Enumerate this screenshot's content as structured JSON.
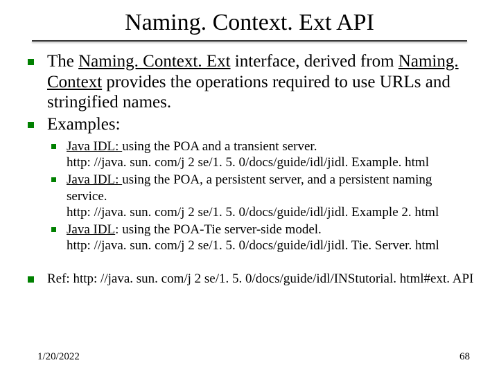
{
  "title": "Naming. Context. Ext API",
  "bullets": [
    {
      "pre": "The ",
      "u1": "Naming. Context. Ext",
      "mid": " interface, derived from ",
      "u2": "Naming. Context",
      "post": " provides the operations required to use URLs and stringified names."
    },
    {
      "text": "Examples:"
    }
  ],
  "sub": [
    {
      "u": "Java IDL: ",
      "rest": "using the POA and a transient server.",
      "url": "http: //java. sun. com/j 2 se/1. 5. 0/docs/guide/idl/jidl. Example. html"
    },
    {
      "u": "Java IDL: ",
      "rest": "using the POA, a persistent server, and a persistent naming service.",
      "url": "http: //java. sun. com/j 2 se/1. 5. 0/docs/guide/idl/jidl. Example 2. html"
    },
    {
      "u": "Java IDL",
      "rest": ": using the POA-Tie server-side model.",
      "url": "http: //java. sun. com/j 2 se/1. 5. 0/docs/guide/idl/jidl. Tie. Server. html"
    }
  ],
  "ref": "Ref: http: //java. sun. com/j 2 se/1. 5. 0/docs/guide/idl/INStutorial. html#ext. API",
  "footer": {
    "date": "1/20/2022",
    "page": "68"
  }
}
